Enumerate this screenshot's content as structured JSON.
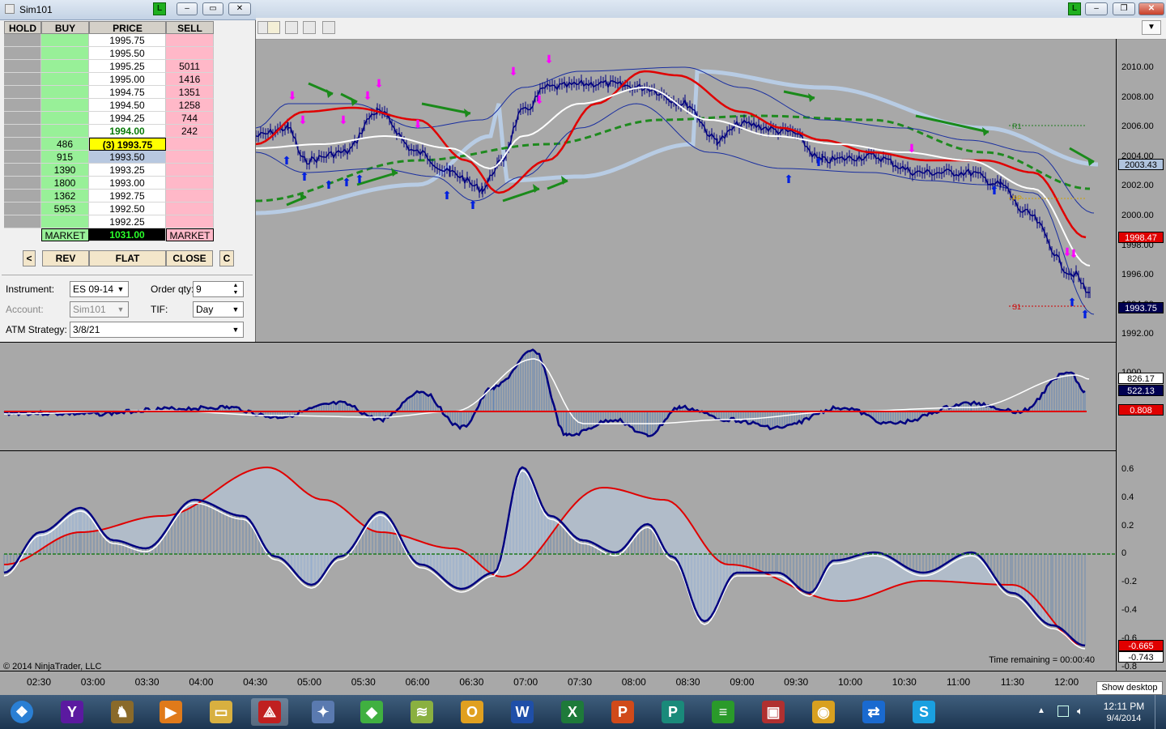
{
  "dom_window": {
    "title": "Sim101",
    "live_indicator": "L",
    "columns": {
      "hold": "HOLD",
      "buy": "BUY",
      "price": "PRICE",
      "sell": "SELL"
    },
    "rows": [
      {
        "buy": "",
        "price": "1995.75",
        "sell": ""
      },
      {
        "buy": "",
        "price": "1995.50",
        "sell": ""
      },
      {
        "buy": "",
        "price": "1995.25",
        "sell": "5011"
      },
      {
        "buy": "",
        "price": "1995.00",
        "sell": "1416"
      },
      {
        "buy": "",
        "price": "1994.75",
        "sell": "1351"
      },
      {
        "buy": "",
        "price": "1994.50",
        "sell": "1258"
      },
      {
        "buy": "",
        "price": "1994.25",
        "sell": "744"
      },
      {
        "buy": "",
        "price": "1994.00",
        "sell": "242"
      },
      {
        "buy": "486",
        "price": "(3) 1993.75",
        "sell": ""
      },
      {
        "buy": "915",
        "price": "1993.50",
        "sell": ""
      },
      {
        "buy": "1390",
        "price": "1993.25",
        "sell": ""
      },
      {
        "buy": "1800",
        "price": "1993.00",
        "sell": ""
      },
      {
        "buy": "1362",
        "price": "1992.75",
        "sell": ""
      },
      {
        "buy": "5953",
        "price": "1992.50",
        "sell": ""
      },
      {
        "buy": "",
        "price": "1992.25",
        "sell": ""
      }
    ],
    "market_buy": "MARKET",
    "pnl": "1031.00",
    "market_sell": "MARKET",
    "buttons": {
      "left": "<",
      "rev": "REV",
      "flat": "FLAT",
      "close": "CLOSE",
      "c": "C"
    },
    "instrument_label": "Instrument:",
    "instrument_value": "ES 09-14",
    "order_qty_label": "Order qty:",
    "order_qty_value": "9",
    "account_label": "Account:",
    "account_value": "Sim101",
    "tif_label": "TIF:",
    "tif_value": "Day",
    "atm_label": "ATM Strategy:",
    "atm_value": "3/8/21"
  },
  "chart": {
    "live_indicator": "L",
    "copyright": "© 2014 NinjaTrader, LLC",
    "time_remaining": "Time remaining = 00:00:40",
    "pivot_r1": "R1",
    "pivot_pp": "PP",
    "pivot_s1": "S1",
    "price_axis_ticks": [
      "2010.00",
      "2008.00",
      "2006.00",
      "2004.00",
      "2002.00",
      "2000.00",
      "1998.00",
      "1996.00",
      "1994.00",
      "1992.00"
    ],
    "price_badges": [
      {
        "value": "2003.43",
        "bg": "#b0c4de",
        "fg": "#000000"
      },
      {
        "value": "1998.47",
        "bg": "#e00000",
        "fg": "#ffffff"
      },
      {
        "value": "1993.75",
        "bg": "#000050",
        "fg": "#ffffff"
      }
    ],
    "ind1_tick": "1000",
    "ind1_badges": [
      {
        "value": "826.17",
        "bg": "#ffffff",
        "fg": "#000000"
      },
      {
        "value": "522.13",
        "bg": "#000050",
        "fg": "#ffffff"
      },
      {
        "value": "0.808",
        "bg": "#e00000",
        "fg": "#ffffff"
      }
    ],
    "ind2_ticks": [
      "0.6",
      "0.4",
      "0.2",
      "0",
      "-0.2",
      "-0.4",
      "-0.6",
      "-0.8"
    ],
    "ind2_badges": [
      {
        "value": "-0.665",
        "bg": "#e00000",
        "fg": "#ffffff"
      },
      {
        "value": "-0.743",
        "bg": "#ffffff",
        "fg": "#000000"
      }
    ],
    "time_axis": [
      "02:30",
      "03:00",
      "03:30",
      "04:00",
      "04:30",
      "05:00",
      "05:30",
      "06:00",
      "06:30",
      "07:00",
      "07:30",
      "08:00",
      "08:30",
      "09:00",
      "09:30",
      "10:00",
      "10:30",
      "11:00",
      "11:30",
      "12:00"
    ]
  },
  "taskbar": {
    "show_desktop": "Show desktop",
    "clock_time": "12:11 PM",
    "clock_date": "9/4/2014",
    "apps": [
      {
        "name": "start-orb-icon",
        "glyph": "❖",
        "color": "#2a7fd4"
      },
      {
        "name": "yahoo-icon",
        "glyph": "Y",
        "color": "#5b1aa0"
      },
      {
        "name": "game-icon",
        "glyph": "♞",
        "color": "#8a6a2a"
      },
      {
        "name": "media-player-icon",
        "glyph": "▶",
        "color": "#e07a1a"
      },
      {
        "name": "file-explorer-icon",
        "glyph": "▭",
        "color": "#d8b040"
      },
      {
        "name": "ninjatrader-icon",
        "glyph": "⟁",
        "color": "#c02020"
      },
      {
        "name": "compass-icon",
        "glyph": "✦",
        "color": "#5a7ab0"
      },
      {
        "name": "green-app-icon",
        "glyph": "◆",
        "color": "#40b040"
      },
      {
        "name": "map-icon",
        "glyph": "≋",
        "color": "#8ab040"
      },
      {
        "name": "outlook-icon",
        "glyph": "O",
        "color": "#e0a020"
      },
      {
        "name": "word-icon",
        "glyph": "W",
        "color": "#1f4fa8"
      },
      {
        "name": "excel-icon",
        "glyph": "X",
        "color": "#1e7a3a"
      },
      {
        "name": "powerpoint-icon",
        "glyph": "P",
        "color": "#d04a1a"
      },
      {
        "name": "publisher-icon",
        "glyph": "P",
        "color": "#1a8a7a"
      },
      {
        "name": "spotify-icon",
        "glyph": "≡",
        "color": "#2a9a2a"
      },
      {
        "name": "red-app-icon",
        "glyph": "▣",
        "color": "#b03030"
      },
      {
        "name": "chrome-icon",
        "glyph": "◉",
        "color": "#d8a020"
      },
      {
        "name": "teamviewer-icon",
        "glyph": "⇄",
        "color": "#1a6ad0"
      },
      {
        "name": "skype-icon",
        "glyph": "S",
        "color": "#1aa0e0"
      }
    ]
  }
}
